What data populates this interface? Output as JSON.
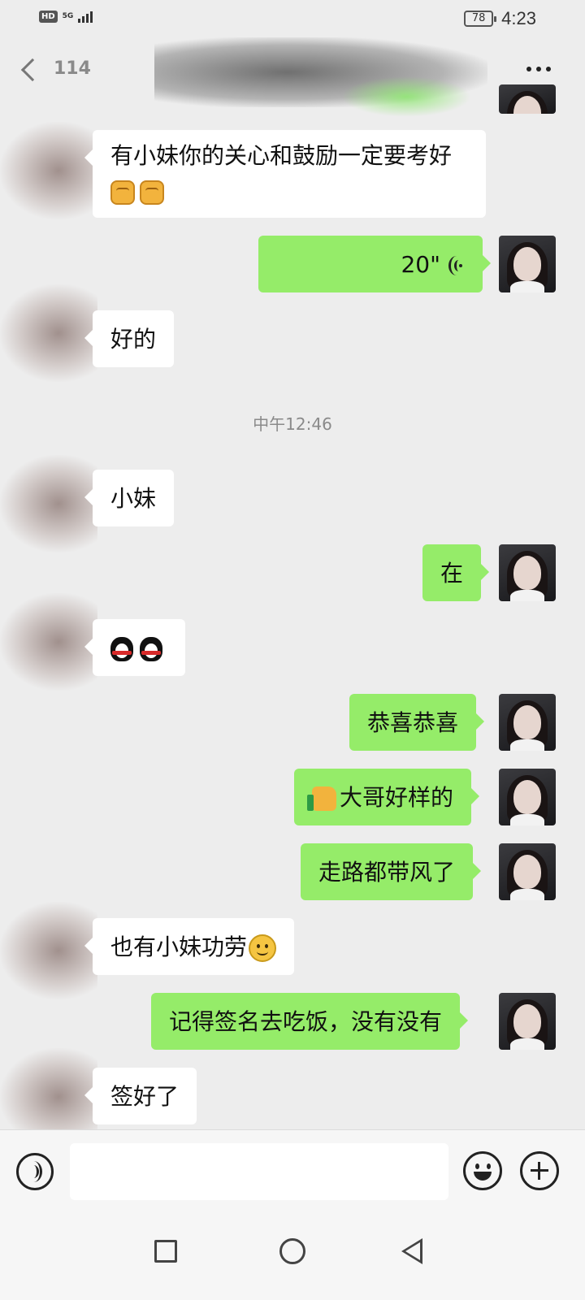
{
  "status_bar": {
    "hd": "HD",
    "network": "5G",
    "battery": "78",
    "time": "4:23"
  },
  "header": {
    "back_count": "114",
    "contact_name": "",
    "more_icon": "more-dots-icon"
  },
  "messages": [
    {
      "side": "left",
      "text": "有小妹你的关心和鼓励一定要考好",
      "emojis": [
        "fist-emoji",
        "fist-emoji"
      ]
    },
    {
      "side": "right",
      "type": "voice",
      "duration": "20\""
    },
    {
      "side": "left",
      "text": "好的"
    },
    {
      "side": "left",
      "text": "小妹"
    },
    {
      "side": "right",
      "text": "在"
    },
    {
      "side": "left",
      "text": "",
      "emojis": [
        "penguin-emoji",
        "penguin-emoji"
      ]
    },
    {
      "side": "right",
      "text": "恭喜恭喜"
    },
    {
      "side": "right",
      "text": "大哥好样的",
      "emoji_prefix": "thumbs-up-emoji"
    },
    {
      "side": "right",
      "text": "走路都带风了"
    },
    {
      "side": "left",
      "text": "也有小妹功劳",
      "emoji_suffix": "smile-emoji"
    },
    {
      "side": "right",
      "text": "记得签名去吃饭，没有没有"
    },
    {
      "side": "left",
      "text": "签好了"
    }
  ],
  "timestamp": "中午12:46",
  "input_bar": {
    "voice_icon": "voice-input-icon",
    "text_value": "",
    "emoji_icon": "emoji-icon",
    "plus_icon": "plus-icon"
  },
  "nav_bar": {
    "recent_icon": "recent-apps-icon",
    "home_icon": "home-icon",
    "back_icon": "back-triangle-icon"
  },
  "colors": {
    "background": "#ededed",
    "sent_bubble": "#95ec69",
    "received_bubble": "#ffffff"
  }
}
